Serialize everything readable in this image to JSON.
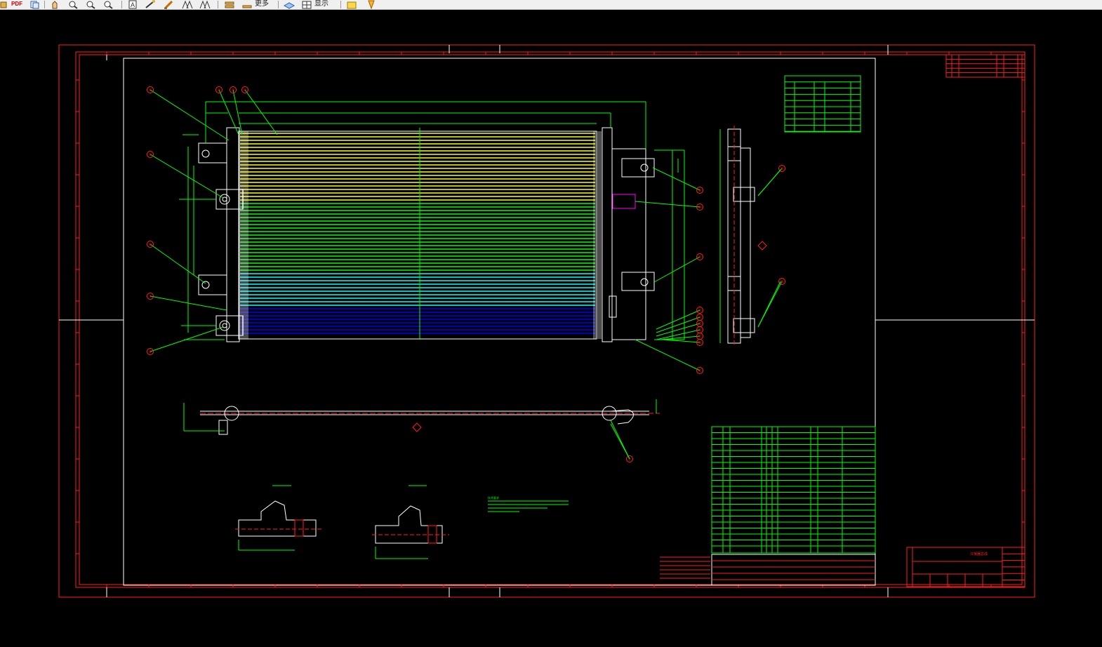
{
  "toolbar": {
    "pdf_label": "PDF",
    "buttons": [
      {
        "id": "pdf",
        "icon": "pdf-export-icon"
      },
      {
        "id": "copy",
        "icon": "copy-icon"
      },
      {
        "id": "pan",
        "icon": "pan-icon"
      },
      {
        "id": "zoom-realtime",
        "icon": "zoom-realtime-icon"
      },
      {
        "id": "zoom-window",
        "icon": "zoom-window-icon"
      },
      {
        "id": "zoom-extents",
        "icon": "zoom-extents-icon"
      },
      {
        "id": "text",
        "icon": "text-icon"
      },
      {
        "id": "measure",
        "icon": "measure-icon"
      },
      {
        "id": "draw",
        "icon": "draw-icon"
      },
      {
        "id": "layers",
        "icon": "layers-icon"
      },
      {
        "id": "layer-manager",
        "icon": "layer-manager-icon"
      },
      {
        "id": "highlight",
        "icon": "highlight-icon"
      },
      {
        "id": "pin",
        "icon": "pin-icon"
      }
    ],
    "more_label": "更多",
    "display_label": "显示"
  },
  "drawing": {
    "title_block_name": "冷凝器总成",
    "callouts": [
      "①",
      "②",
      "③",
      "④",
      "⑤",
      "⑥",
      "⑦",
      "⑧",
      "⑨",
      "⑩",
      "⑪",
      "⑫",
      "⑬",
      "⑭",
      "⑮",
      "⑯",
      "⑰",
      "⑱",
      "⑲",
      "⑳"
    ],
    "note_label": "技术要求"
  },
  "colors": {
    "border": "#ff0000",
    "dimension": "#00ff00",
    "outline": "#ffffff",
    "core_yellow": "#ffff00",
    "core_cyan": "#00ffff",
    "core_blue": "#0000ff",
    "accent_magenta": "#ff00ff"
  }
}
